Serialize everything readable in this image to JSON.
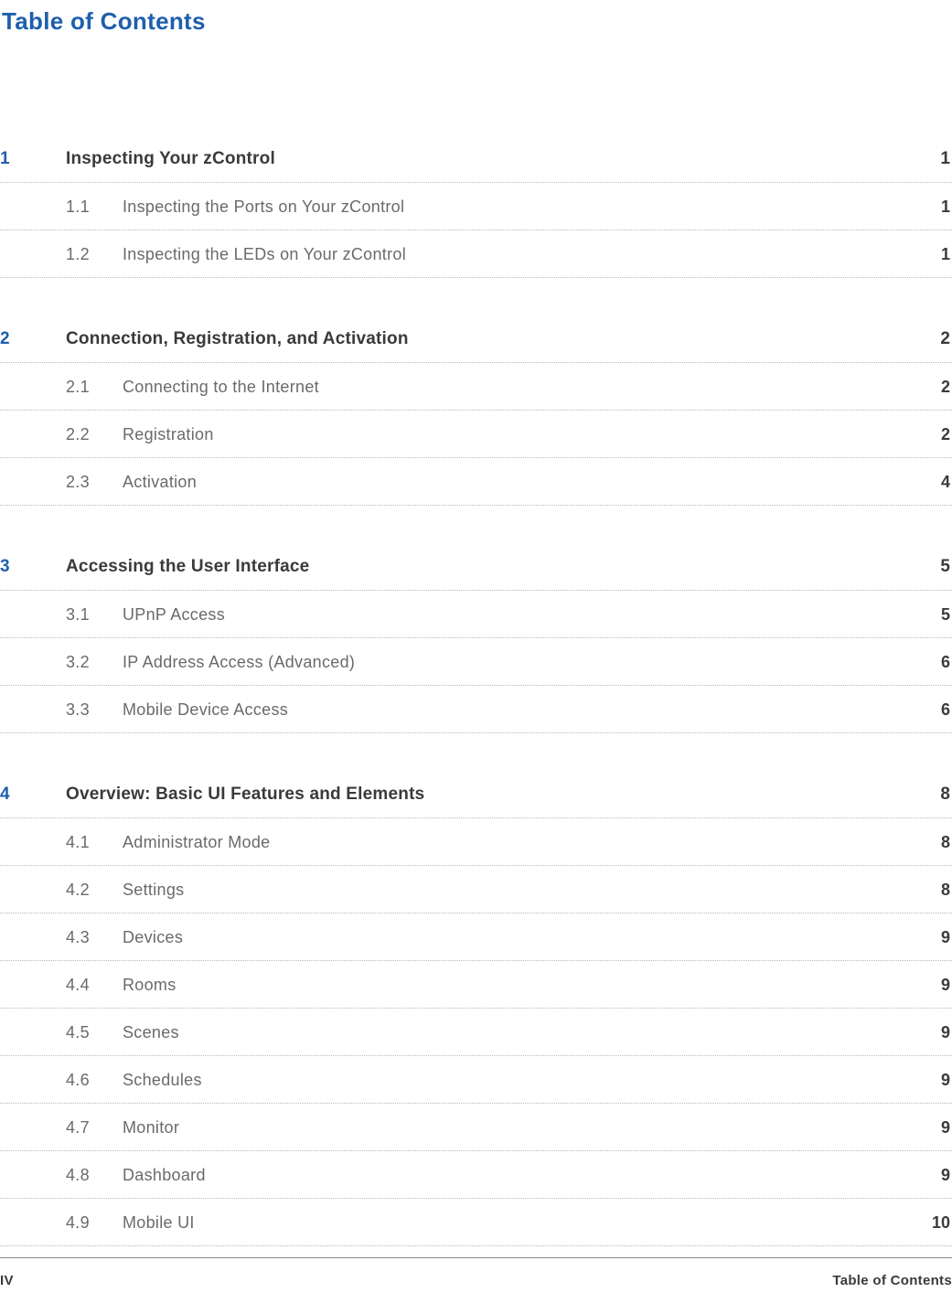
{
  "title": "Table of Contents",
  "footer": {
    "left": "IV",
    "right": "Table of Contents"
  },
  "chapters": [
    {
      "num": "1",
      "title": "Inspecting Your zControl",
      "page": "1",
      "subs": [
        {
          "num": "1.1",
          "title": "Inspecting the Ports on Your zControl",
          "page": "1"
        },
        {
          "num": "1.2",
          "title": "Inspecting the LEDs on Your zControl",
          "page": "1"
        }
      ]
    },
    {
      "num": "2",
      "title": "Connection, Registration, and Activation",
      "page": "2",
      "subs": [
        {
          "num": "2.1",
          "title": "Connecting to the Internet",
          "page": "2"
        },
        {
          "num": "2.2",
          "title": "Registration",
          "page": "2"
        },
        {
          "num": "2.3",
          "title": "Activation",
          "page": "4"
        }
      ]
    },
    {
      "num": "3",
      "title": "Accessing the User Interface",
      "page": "5",
      "subs": [
        {
          "num": "3.1",
          "title": "UPnP Access",
          "page": "5"
        },
        {
          "num": "3.2",
          "title": "IP Address Access (Advanced)",
          "page": "6"
        },
        {
          "num": "3.3",
          "title": "Mobile Device Access",
          "page": "6"
        }
      ]
    },
    {
      "num": "4",
      "title": "Overview:  Basic UI Features and Elements",
      "page": "8",
      "subs": [
        {
          "num": "4.1",
          "title": "Administrator Mode",
          "page": "8"
        },
        {
          "num": "4.2",
          "title": "Settings",
          "page": "8"
        },
        {
          "num": "4.3",
          "title": "Devices",
          "page": "9"
        },
        {
          "num": "4.4",
          "title": "Rooms",
          "page": "9"
        },
        {
          "num": "4.5",
          "title": "Scenes",
          "page": "9"
        },
        {
          "num": "4.6",
          "title": "Schedules",
          "page": "9"
        },
        {
          "num": "4.7",
          "title": "Monitor",
          "page": "9"
        },
        {
          "num": "4.8",
          "title": "Dashboard",
          "page": "9"
        },
        {
          "num": "4.9",
          "title": "Mobile UI",
          "page": "10"
        }
      ]
    }
  ]
}
